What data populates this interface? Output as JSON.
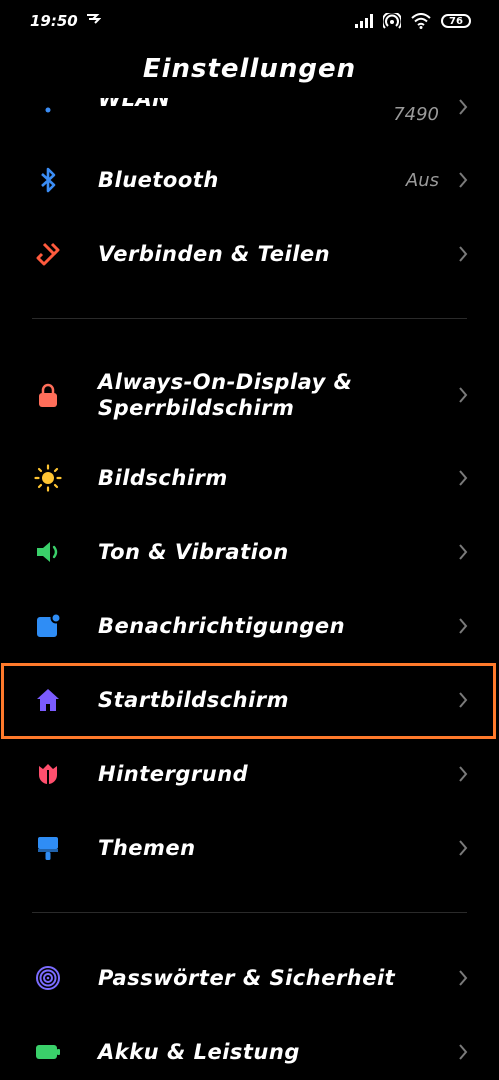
{
  "status": {
    "time": "19:50",
    "battery": "76"
  },
  "header": {
    "title": "Einstellungen"
  },
  "items": [
    {
      "label": "WLAN",
      "value": "7490"
    },
    {
      "label": "Bluetooth",
      "value": "Aus"
    },
    {
      "label": "Verbinden & Teilen"
    },
    {
      "label": "Always-On-Display &",
      "label2": "Sperrbildschirm"
    },
    {
      "label": "Bildschirm"
    },
    {
      "label": "Ton & Vibration"
    },
    {
      "label": "Benachrichtigungen"
    },
    {
      "label": "Startbildschirm"
    },
    {
      "label": "Hintergrund"
    },
    {
      "label": "Themen"
    },
    {
      "label": "Passwörter & Sicherheit"
    },
    {
      "label": "Akku & Leistung"
    }
  ],
  "colors": {
    "highlight": "#ff7a2b",
    "bluetooth": "#3b8df5",
    "share": "#ff5a3d",
    "lock": "#ff6e5a",
    "sun": "#ffc533",
    "sound": "#3ad06a",
    "notify": "#2f8df5",
    "home": "#7b5cff",
    "wallpaper": "#ff4f6d",
    "themes": "#2f8df5",
    "security": "#7b6cff",
    "battery": "#3ad06a"
  }
}
